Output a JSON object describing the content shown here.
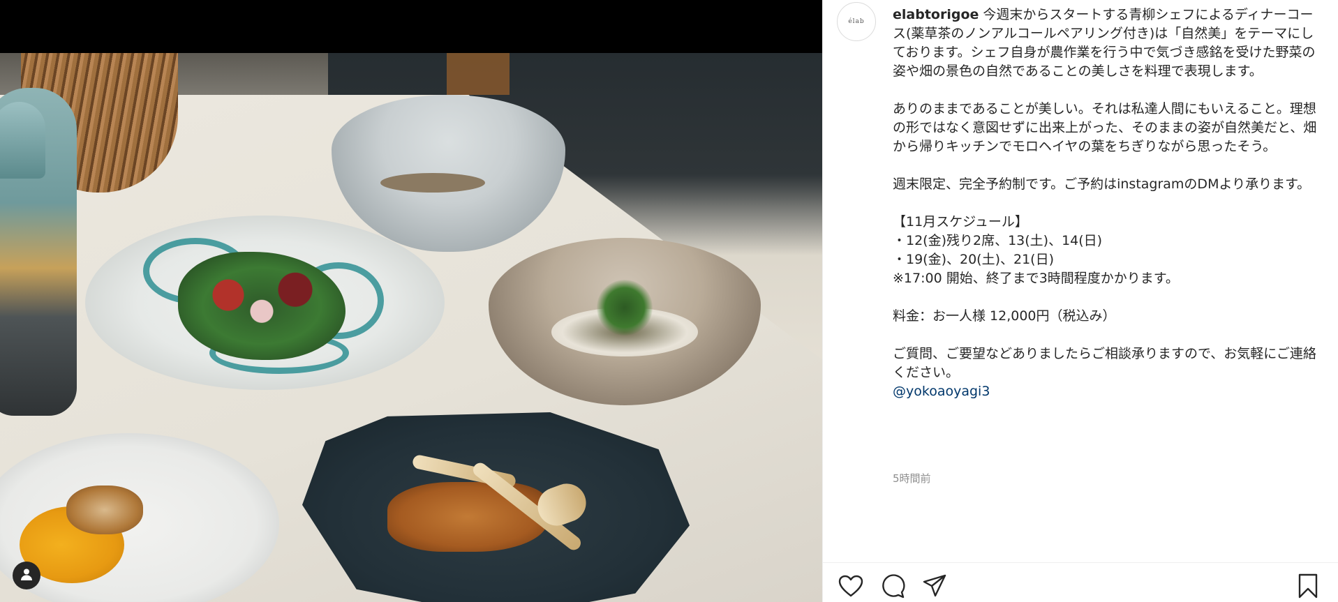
{
  "post": {
    "username": "elabtorigoe",
    "profile_logo_text": "élab",
    "caption_lines": [
      "今週末からスタートする青柳シェフによるディナーコース(薬草茶のノンアルコールペアリング付き)は「自然美」をテーマにしております。シェフ自身が農作業を行う中で気づき感銘を受けた野菜の姿や畑の景色の自然であることの美しさを料理で表現します。",
      "ありのままであることが美しい。それは私達人間にもいえること。理想の形ではなく意図せずに出来上がった、そのままの姿が自然美だと、畑から帰りキッチンでモロヘイヤの葉をちぎりながら思ったそう。",
      "週末限定、完全予約制です。ご予約はinstagramのDMより承ります。",
      "【11月スケジュール】",
      "・12(金)残り2席、13(土)、14(日)",
      "・19(金)、20(土)、21(日)",
      "※17:00 開始、終了まで3時間程度かかります。",
      "料金：お一人様 12,000円（税込み）",
      "ご質問、ご要望などありましたらご相談承りますので、お気軽にご連絡ください。"
    ],
    "mention": "@yokoaoyagi3",
    "timestamp": "5時間前"
  },
  "icons": {
    "like": "heart-icon",
    "comment": "comment-icon",
    "share": "share-icon",
    "save": "bookmark-icon",
    "tagged_user": "user-icon"
  },
  "colors": {
    "text": "#262626",
    "mention": "#00376b",
    "timestamp": "#8e8e8e"
  }
}
